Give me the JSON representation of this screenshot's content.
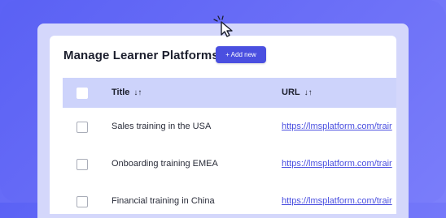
{
  "header": {
    "title": "Manage Learner Platforms",
    "add_button_label": "+ Add new"
  },
  "table": {
    "columns": [
      {
        "label": "Title",
        "sort_icon": "↓↑"
      },
      {
        "label": "URL",
        "sort_icon": "↓↑"
      }
    ],
    "rows": [
      {
        "title": "Sales training in the USA",
        "url": "https://lmsplatform.com/trair"
      },
      {
        "title": "Onboarding training EMEA",
        "url": "https://lmsplatform.com/trair"
      },
      {
        "title": "Financial training in China",
        "url": "https://lmsplatform.com/trair"
      }
    ]
  },
  "colors": {
    "accent": "#4a4fe0",
    "background": "#5b62f5",
    "table_header": "#cdd3fb"
  }
}
